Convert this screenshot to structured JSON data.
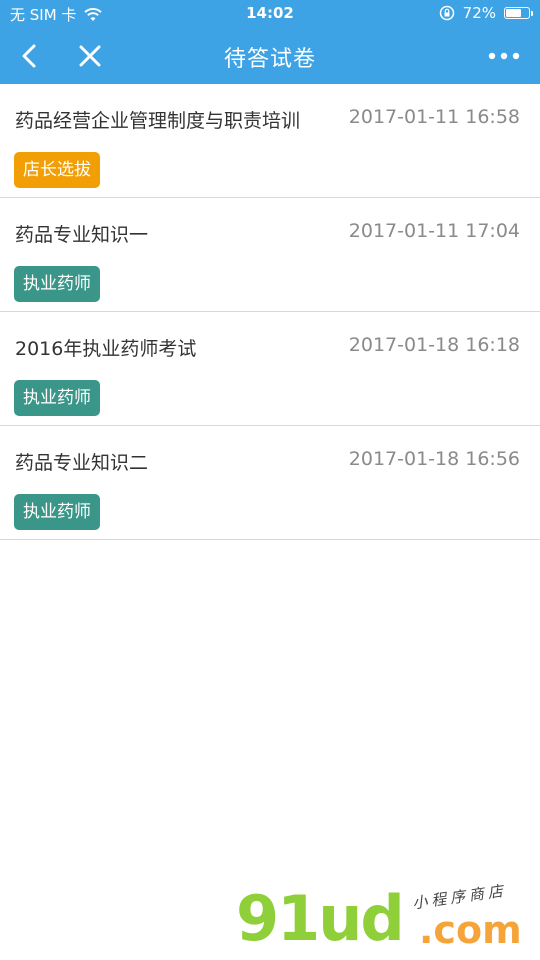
{
  "status_bar": {
    "carrier": "无 SIM 卡",
    "time": "14:02",
    "battery_percent": "72%",
    "battery_level": 0.72
  },
  "nav": {
    "title": "待答试卷"
  },
  "items": [
    {
      "title": "药品经营企业管理制度与职责培训",
      "time": "2017-01-11 16:58",
      "tag": "店长选拔",
      "tag_color": "#f29f05"
    },
    {
      "title": "药品专业知识一",
      "time": "2017-01-11 17:04",
      "tag": "执业药师",
      "tag_color": "#3a9688"
    },
    {
      "title": "2016年执业药师考试",
      "time": "2017-01-18 16:18",
      "tag": "执业药师",
      "tag_color": "#3a9688"
    },
    {
      "title": "药品专业知识二",
      "time": "2017-01-18 16:56",
      "tag": "执业药师",
      "tag_color": "#3a9688"
    }
  ],
  "watermark": {
    "brand": "91ud",
    "domain": ".com",
    "subtitle": "小程序商店"
  },
  "colors": {
    "header": "#3da3e5",
    "tag_orange": "#f29f05",
    "tag_teal": "#3a9688"
  }
}
